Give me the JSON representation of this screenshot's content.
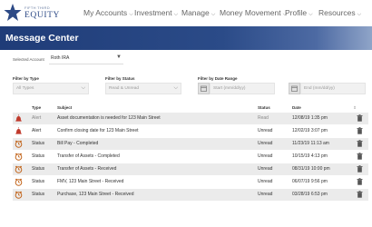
{
  "brand": {
    "small": "FIFTH THIRD",
    "name": "EQUITY"
  },
  "nav": [
    {
      "label": "My Accounts"
    },
    {
      "label": "Investment"
    },
    {
      "label": "Manage"
    },
    {
      "label": "Money Movement"
    },
    {
      "label": "Profile"
    },
    {
      "label": "Resources"
    }
  ],
  "page_title": "Message Center",
  "account": {
    "label": "Selected Account",
    "value": "Roth IRA"
  },
  "filters": {
    "type": {
      "label": "Filter by Type",
      "value": "All Types"
    },
    "status": {
      "label": "Filter by Status",
      "value": "Read & Unread"
    },
    "date": {
      "label": "Filter by Date Range",
      "start_placeholder": "Start (mm/dd/yy)",
      "end_placeholder": "End (mm/dd/yy)"
    }
  },
  "table": {
    "headers": {
      "type": "Type",
      "subject": "Subject",
      "status": "Status",
      "date": "Date"
    },
    "rows": [
      {
        "icon": "alert-icon",
        "type": "Alert",
        "subject": "Asset documentation is needed for 123 Main Street",
        "status": "Read",
        "date": "12/08/19 1:35 pm"
      },
      {
        "icon": "alert-icon",
        "type": "Alert",
        "subject": "Confirm closing date for 123 Main Street",
        "status": "Unread",
        "date": "12/02/19 3:07 pm"
      },
      {
        "icon": "clock-icon",
        "type": "Status",
        "subject": "Bill Pay - Completed",
        "status": "Unread",
        "date": "11/23/19 11:13 am"
      },
      {
        "icon": "clock-icon",
        "type": "Status",
        "subject": "Transfer of Assets - Completed",
        "status": "Unread",
        "date": "10/15/19 4:13 pm"
      },
      {
        "icon": "clock-icon",
        "type": "Status",
        "subject": "Transfer of Assets - Received",
        "status": "Unread",
        "date": "08/31/19 10:00 pm"
      },
      {
        "icon": "clock-icon",
        "type": "Status",
        "subject": "FMV, 123 Main Street - Received",
        "status": "Unread",
        "date": "06/07/19 9:56 pm"
      },
      {
        "icon": "clock-icon",
        "type": "Status",
        "subject": "Purchase, 123 Main Street - Received",
        "status": "Unread",
        "date": "03/28/19 6:53 pm"
      }
    ]
  },
  "colors": {
    "brand": "#2d4a86",
    "banner": "#1f3c78",
    "alert": "#c0392b",
    "status_icon": "#c2641b"
  }
}
